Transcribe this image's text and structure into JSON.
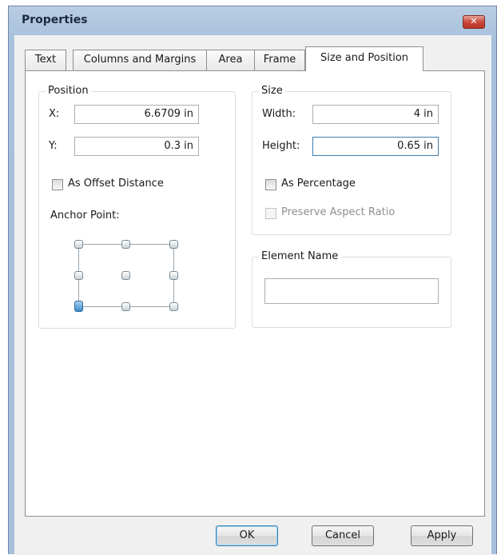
{
  "window": {
    "title": "Properties",
    "close_glyph": "✕"
  },
  "tabs": [
    {
      "label": "Text",
      "active": false
    },
    {
      "label": "Columns and Margins",
      "active": false
    },
    {
      "label": "Area",
      "active": false
    },
    {
      "label": "Frame",
      "active": false
    },
    {
      "label": "Size and Position",
      "active": true
    }
  ],
  "position": {
    "legend": "Position",
    "x_label": "X:",
    "x_value": "6.6709 in",
    "y_label": "Y:",
    "y_value": "0.3 in",
    "offset_label": "As Offset Distance",
    "offset_checked": false,
    "anchor_label": "Anchor Point:",
    "anchor_selected": "bottom-left"
  },
  "size": {
    "legend": "Size",
    "width_label": "Width:",
    "width_value": "4 in",
    "height_label": "Height:",
    "height_value": "0.65 in",
    "percentage_label": "As Percentage",
    "percentage_checked": false,
    "aspect_label": "Preserve Aspect Ratio",
    "aspect_enabled": false
  },
  "element_name": {
    "legend": "Element Name",
    "value": ""
  },
  "buttons": {
    "ok": "OK",
    "cancel": "Cancel",
    "apply": "Apply"
  }
}
